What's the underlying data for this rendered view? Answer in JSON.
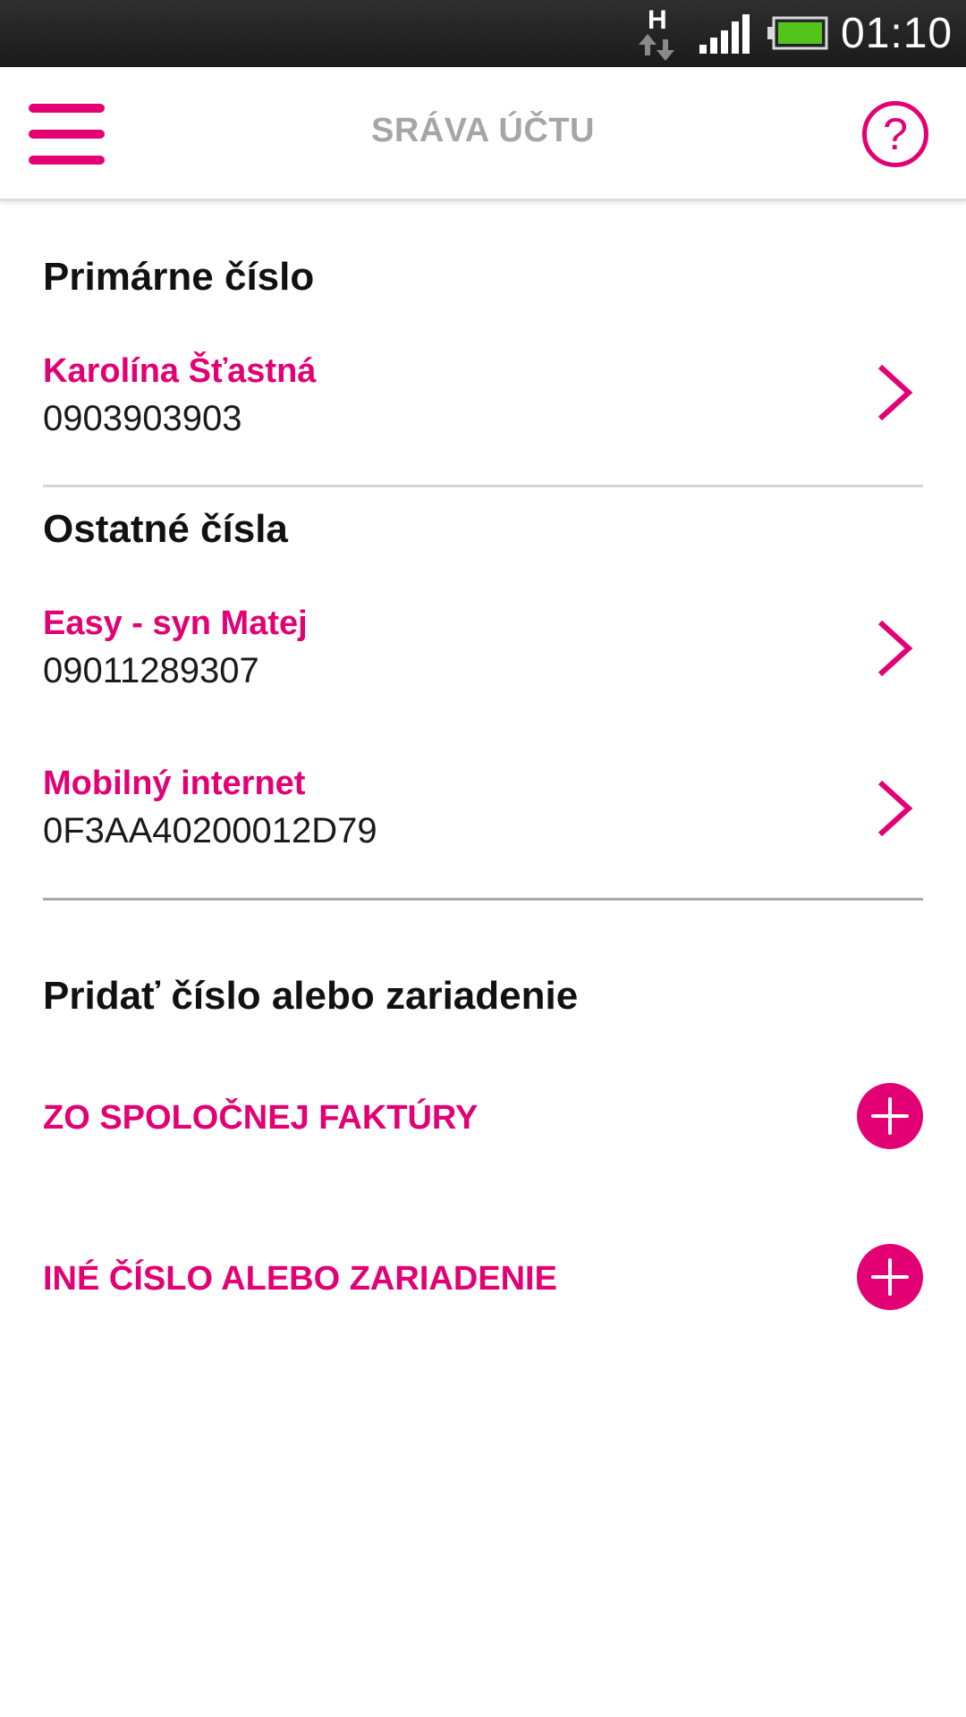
{
  "status_bar": {
    "network_type": "H",
    "network_icon": "h-data-arrows-icon",
    "signal_icon": "signal-strength-icon",
    "battery_icon": "battery-icon",
    "time": "01:10"
  },
  "app_bar": {
    "menu_icon": "hamburger-menu-icon",
    "title": "SRÁVA ÚČTU",
    "help_icon": "question-mark-circle-icon",
    "help_glyph": "?"
  },
  "primary": {
    "heading": "Primárne číslo",
    "item": {
      "name": "Karolína Šťastná",
      "number": "0903903903"
    }
  },
  "others": {
    "heading": "Ostatné čísla",
    "items": [
      {
        "name": "Easy - syn Matej",
        "number": "09011289307"
      },
      {
        "name": "Mobilný internet",
        "number": "0F3AA40200012D79"
      }
    ]
  },
  "add": {
    "heading": "Pridať číslo alebo zariadenie",
    "actions": [
      {
        "label": "ZO SPOLOČNEJ FAKTÚRY",
        "icon": "plus-circle-icon"
      },
      {
        "label": "INÉ ČÍSLO ALEBO ZARIADENIE",
        "icon": "plus-circle-icon"
      }
    ]
  },
  "colors": {
    "accent": "#e20074",
    "title_gray": "#a6a6a6",
    "status_bar": "#1f1f1f",
    "battery_fill": "#55c41a"
  }
}
